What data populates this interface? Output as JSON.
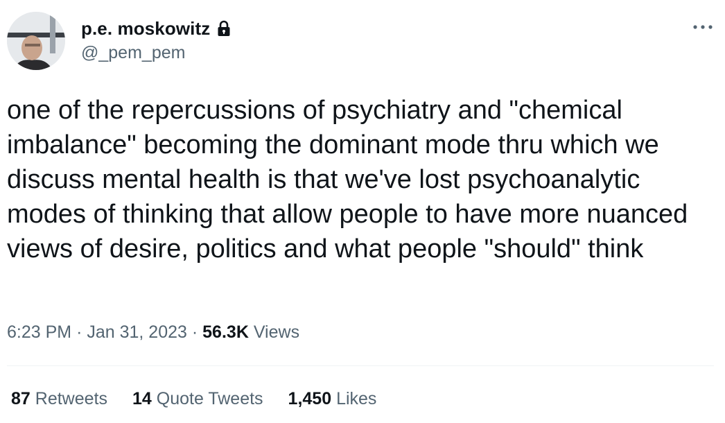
{
  "author": {
    "display_name": "p.e. moskowitz",
    "handle": "@_pem_pem",
    "protected": true,
    "avatar_icon": "profile-photo"
  },
  "tweet": {
    "text": "one of the repercussions of psychiatry and \"chemical imbalance\" becoming the dominant mode thru which we discuss mental health is that we've lost psychoanalytic modes of thinking that allow people to have more nuanced views of desire, politics and what people \"should\" think",
    "time": "6:23 PM",
    "separator": "·",
    "date": "Jan 31, 2023",
    "views_count": "56.3K",
    "views_label": "Views"
  },
  "stats": {
    "retweets_count": "87",
    "retweets_label": "Retweets",
    "quotes_count": "14",
    "quotes_label": "Quote Tweets",
    "likes_count": "1,450",
    "likes_label": "Likes"
  },
  "more_icon": "ellipsis-icon",
  "colors": {
    "text_primary": "#0f1419",
    "text_secondary": "#536471",
    "divider": "#eff3f4"
  }
}
